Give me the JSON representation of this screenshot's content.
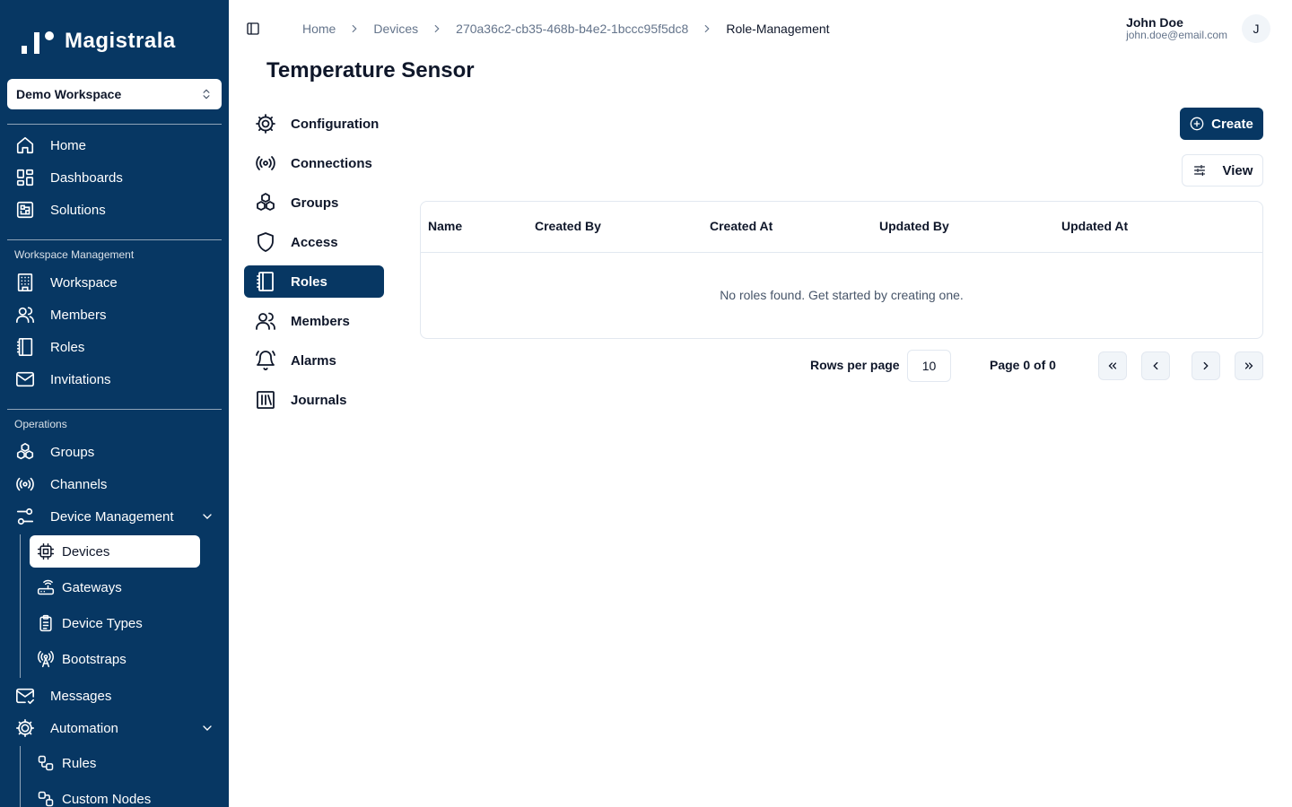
{
  "app": {
    "name": "Magistrala"
  },
  "workspace": {
    "selected": "Demo Workspace"
  },
  "sidebar": {
    "top_items": [
      {
        "label": "Home",
        "icon": "home-icon"
      },
      {
        "label": "Dashboards",
        "icon": "dashboard-icon"
      },
      {
        "label": "Solutions",
        "icon": "solutions-icon"
      }
    ],
    "workspace_section": {
      "label": "Workspace Management",
      "items": [
        {
          "label": "Workspace",
          "icon": "building-icon"
        },
        {
          "label": "Members",
          "icon": "users-icon"
        },
        {
          "label": "Roles",
          "icon": "roles-icon"
        },
        {
          "label": "Invitations",
          "icon": "mail-icon"
        }
      ]
    },
    "operations_section": {
      "label": "Operations",
      "items": [
        {
          "label": "Groups",
          "icon": "groups-icon"
        },
        {
          "label": "Channels",
          "icon": "radio-icon"
        }
      ],
      "device_management": {
        "label": "Device Management",
        "sub_items": [
          {
            "label": "Devices",
            "icon": "cpu-icon",
            "active": true
          },
          {
            "label": "Gateways",
            "icon": "router-icon"
          },
          {
            "label": "Device Types",
            "icon": "clipboard-icon"
          },
          {
            "label": "Bootstraps",
            "icon": "antenna-icon"
          }
        ]
      },
      "messages": {
        "label": "Messages"
      },
      "automation": {
        "label": "Automation",
        "sub_items": [
          {
            "label": "Rules",
            "icon": "workflow-icon"
          },
          {
            "label": "Custom Nodes",
            "icon": "custom-nodes-icon"
          }
        ]
      }
    }
  },
  "breadcrumb": [
    "Home",
    "Devices",
    "270a36c2-cb35-468b-b4e2-1bccc95f5dc8",
    "Role-Management"
  ],
  "user": {
    "name": "John Doe",
    "email": "john.doe@email.com",
    "initial": "J"
  },
  "page": {
    "title": "Temperature Sensor"
  },
  "tabs": [
    {
      "label": "Configuration",
      "icon": "gear-icon"
    },
    {
      "label": "Connections",
      "icon": "radio-icon"
    },
    {
      "label": "Groups",
      "icon": "groups-icon"
    },
    {
      "label": "Access",
      "icon": "shield-icon"
    },
    {
      "label": "Roles",
      "icon": "roles-icon",
      "active": true
    },
    {
      "label": "Members",
      "icon": "users-icon"
    },
    {
      "label": "Alarms",
      "icon": "bell-icon"
    },
    {
      "label": "Journals",
      "icon": "journal-icon"
    }
  ],
  "actions": {
    "create_label": "Create",
    "view_label": "View"
  },
  "table": {
    "columns": [
      "Name",
      "Created By",
      "Created At",
      "Updated By",
      "Updated At"
    ],
    "empty_message": "No roles found. Get started by creating one."
  },
  "pagination": {
    "rows_per_page_label": "Rows per page",
    "rows_per_page": "10",
    "page_info": "Page 0 of 0"
  },
  "colors": {
    "primary": "#073763",
    "sidebar_bg": "#073763",
    "border": "#e2e8f0",
    "muted_text": "#64748b"
  }
}
